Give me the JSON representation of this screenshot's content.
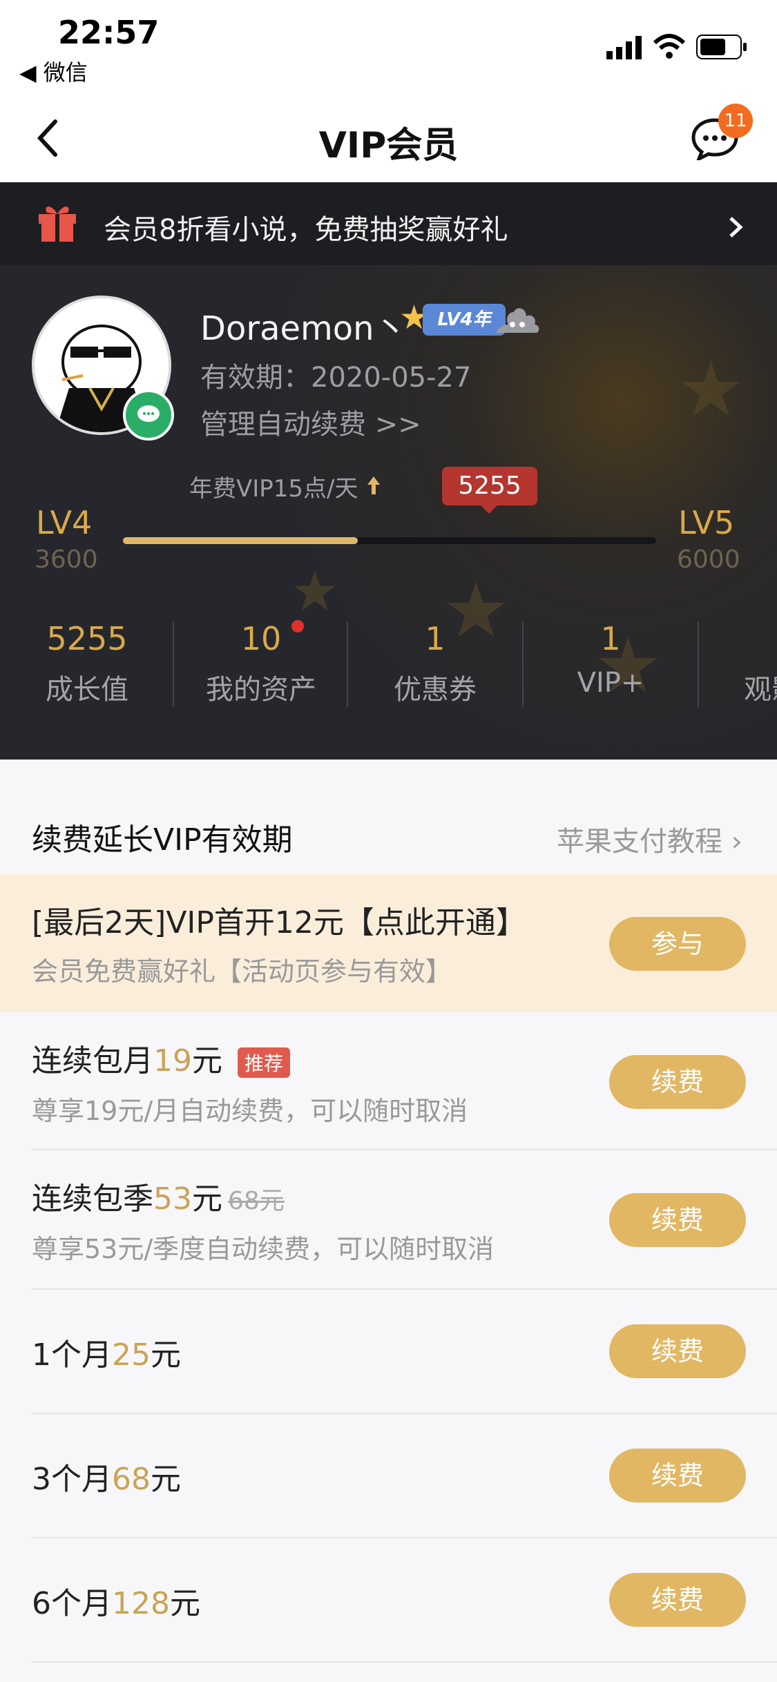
{
  "status": {
    "time": "22:57",
    "back_app": "◀ 微信"
  },
  "nav": {
    "title": "VIP会员",
    "badge_count": "11"
  },
  "banner": {
    "text": "会员8折看小说，免费抽奖赢好礼"
  },
  "profile": {
    "username": "Doraemon丶",
    "level_tag": "LV4年",
    "expire_label": "有效期：2020-05-27",
    "manage_label": "管理自动续费 >>"
  },
  "progress": {
    "year_fee_label": "年费VIP15点/天",
    "current_value": "5255",
    "current_level": "LV4",
    "current_level_points": "3600",
    "next_level": "LV5",
    "next_level_points": "6000",
    "fraction": 0.44
  },
  "stats": [
    {
      "value": "5255",
      "label": "成长值"
    },
    {
      "value": "10",
      "label": "我的资产"
    },
    {
      "value": "1",
      "label": "优惠券"
    },
    {
      "value": "1",
      "label": "VIP+"
    },
    {
      "value": "",
      "label": "观影"
    }
  ],
  "renew": {
    "section_title": "续费延长VIP有效期",
    "tutorial_link": "苹果支付教程",
    "promo": {
      "title": "[最后2天]VIP首开12元【点此开通】",
      "subtitle": "会员免费赢好礼【活动页参与有效】",
      "button": "参与"
    },
    "plans": [
      {
        "prefix": "连续包月",
        "price": "19",
        "suffix": "元",
        "tag": "推荐",
        "subtitle": "尊享19元/月自动续费，可以随时取消",
        "button": "续费"
      },
      {
        "prefix": "连续包季",
        "price": "53",
        "suffix": "元",
        "original": "68元",
        "subtitle": "尊享53元/季度自动续费，可以随时取消",
        "button": "续费"
      },
      {
        "prefix": "1个月",
        "price": "25",
        "suffix": "元",
        "button": "续费"
      },
      {
        "prefix": "3个月",
        "price": "68",
        "suffix": "元",
        "button": "续费"
      },
      {
        "prefix": "6个月",
        "price": "128",
        "suffix": "元",
        "button": "续费"
      }
    ]
  },
  "colors": {
    "gold": "#e1b764",
    "dark_bg": "#26272c",
    "promo_bg": "#faeedb",
    "red": "#b5362f"
  }
}
